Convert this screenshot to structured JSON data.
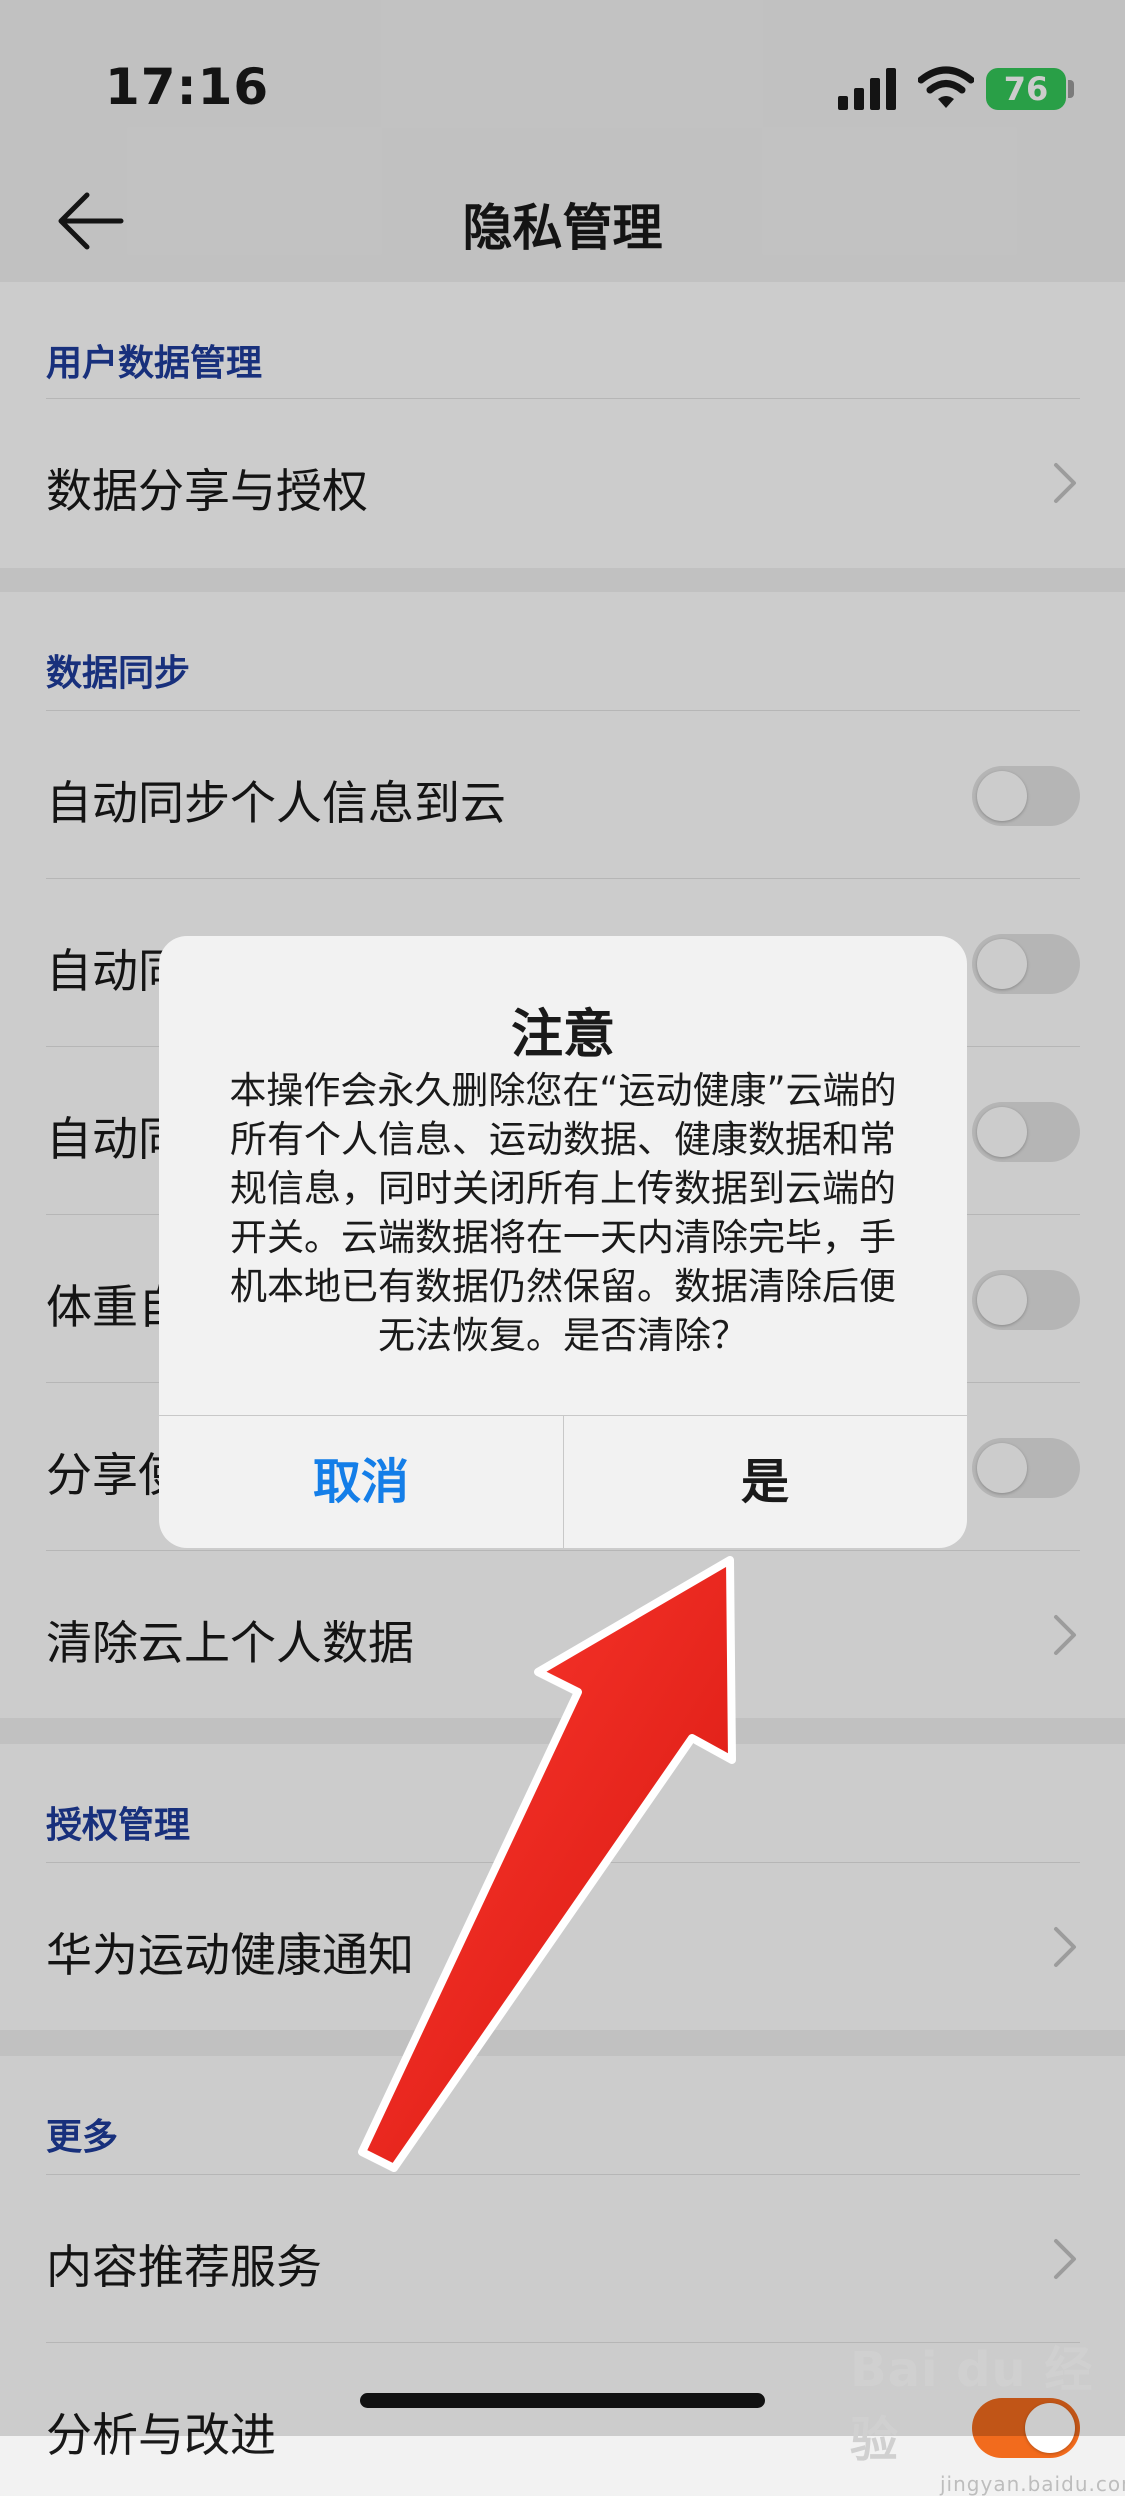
{
  "status": {
    "time": "17:16",
    "battery": "76"
  },
  "nav": {
    "title": "隐私管理"
  },
  "sections": {
    "user_data": {
      "title": "用户数据管理",
      "rows": [
        {
          "label": "数据分享与授权"
        }
      ]
    },
    "sync": {
      "title": "数据同步",
      "rows": [
        {
          "label": "自动同步个人信息到云",
          "toggle": false
        },
        {
          "label": "自动同",
          "toggle": false
        },
        {
          "label": "自动同",
          "toggle": false
        },
        {
          "label": "体重自",
          "toggle": false
        },
        {
          "label": "分享使",
          "toggle": false
        },
        {
          "label": "清除云上个人数据"
        }
      ]
    },
    "auth": {
      "title": "授权管理",
      "rows": [
        {
          "label": "华为运动健康通知"
        }
      ]
    },
    "more": {
      "title": "更多",
      "rows": [
        {
          "label": "内容推荐服务"
        },
        {
          "label": "分析与改进",
          "toggle": true
        }
      ]
    }
  },
  "dialog": {
    "title": "注意",
    "message": "本操作会永久删除您在“运动健康”云端的所有个人信息、运动数据、健康数据和常规信息，同时关闭所有上传数据到云端的开关。云端数据将在一天内清除完毕，手机本地已有数据仍然保留。数据清除后便无法恢复。是否清除？",
    "cancel": "取消",
    "confirm": "是"
  },
  "watermark": {
    "brand": "Bai du 经验",
    "url": "jingyan.baidu.com"
  },
  "colors": {
    "accent": "#147ee8",
    "section_title": "#1f3c9c",
    "toggle_on": "#f26b1d",
    "arrow": "#e8231c"
  }
}
